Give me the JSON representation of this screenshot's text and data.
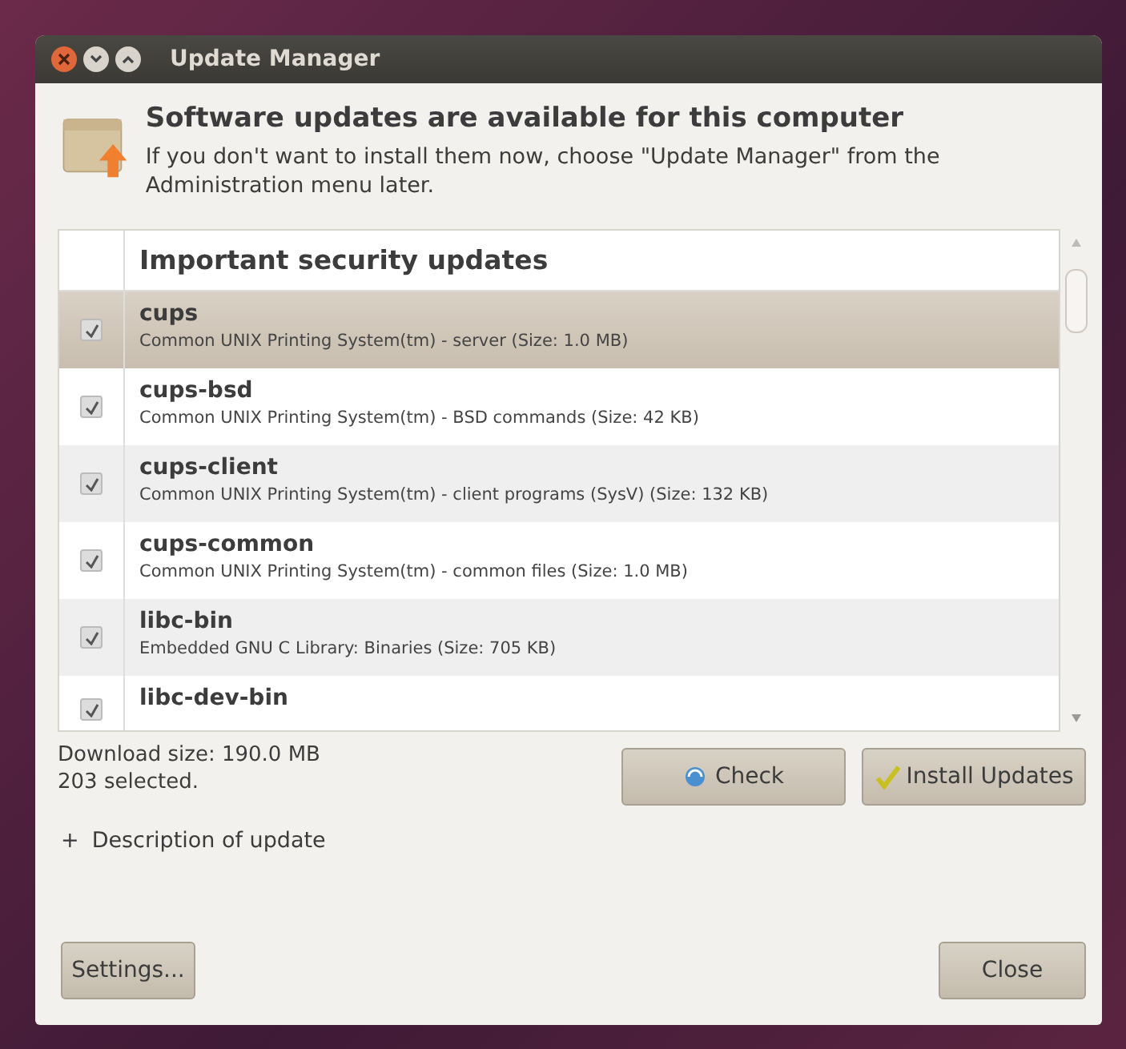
{
  "window": {
    "title": "Update Manager"
  },
  "header": {
    "title": "Software updates are available for this computer",
    "subtitle": "If you don't want to install them now, choose \"Update Manager\" from the Administration menu later."
  },
  "list": {
    "section": "Important security updates",
    "rows": [
      {
        "name": "cups",
        "description": "Common UNIX Printing System(tm) - server (Size: 1.0 MB)",
        "checked": true,
        "selected": true
      },
      {
        "name": "cups-bsd",
        "description": "Common UNIX Printing System(tm) - BSD commands (Size: 42 KB)",
        "checked": true,
        "selected": false
      },
      {
        "name": "cups-client",
        "description": "Common UNIX Printing System(tm) - client programs (SysV) (Size: 132 KB)",
        "checked": true,
        "selected": false
      },
      {
        "name": "cups-common",
        "description": "Common UNIX Printing System(tm) - common files (Size: 1.0 MB)",
        "checked": true,
        "selected": false
      },
      {
        "name": "libc-bin",
        "description": "Embedded GNU C Library: Binaries (Size: 705 KB)",
        "checked": true,
        "selected": false
      },
      {
        "name": "libc-dev-bin",
        "checked": true,
        "selected": false
      }
    ]
  },
  "summary": {
    "download_size": "Download size: 190.0 MB",
    "selected_count": "203 selected."
  },
  "buttons": {
    "check": "Check",
    "install": "Install Updates",
    "settings": "Settings...",
    "close": "Close"
  },
  "expander": {
    "symbol": "+",
    "label": "Description of update",
    "expanded": false
  }
}
